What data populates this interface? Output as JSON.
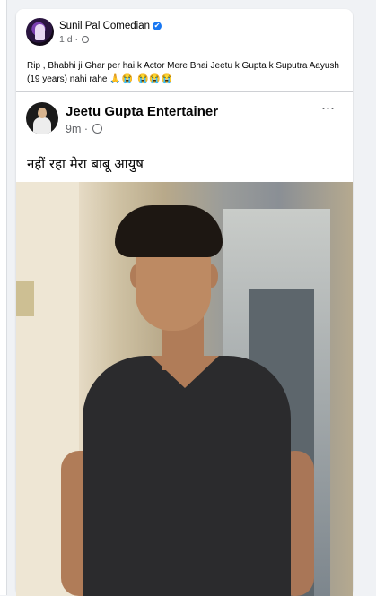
{
  "outer_post": {
    "author": "Sunil Pal Comedian",
    "verified_mark": "✔",
    "time": "1 d ·",
    "text": "Rip , Bhabhi ji Ghar per hai k Actor Mere Bhai Jeetu k Gupta k Suputra Aayush (19 years) nahi rahe",
    "emojis": "🙏😭 😭😭😭"
  },
  "shared_post": {
    "author": "Jeetu Gupta Entertainer",
    "time": "9m ·",
    "more_label": "···",
    "text": "नहीं रहा मेरा बाबू आयुष"
  },
  "icons": {
    "verified": "verified-badge-icon",
    "audience": "globe-icon",
    "more": "more-options-icon"
  },
  "colors": {
    "accent": "#1877f2",
    "secondary_text": "#65676b",
    "background": "#f0f2f5"
  }
}
